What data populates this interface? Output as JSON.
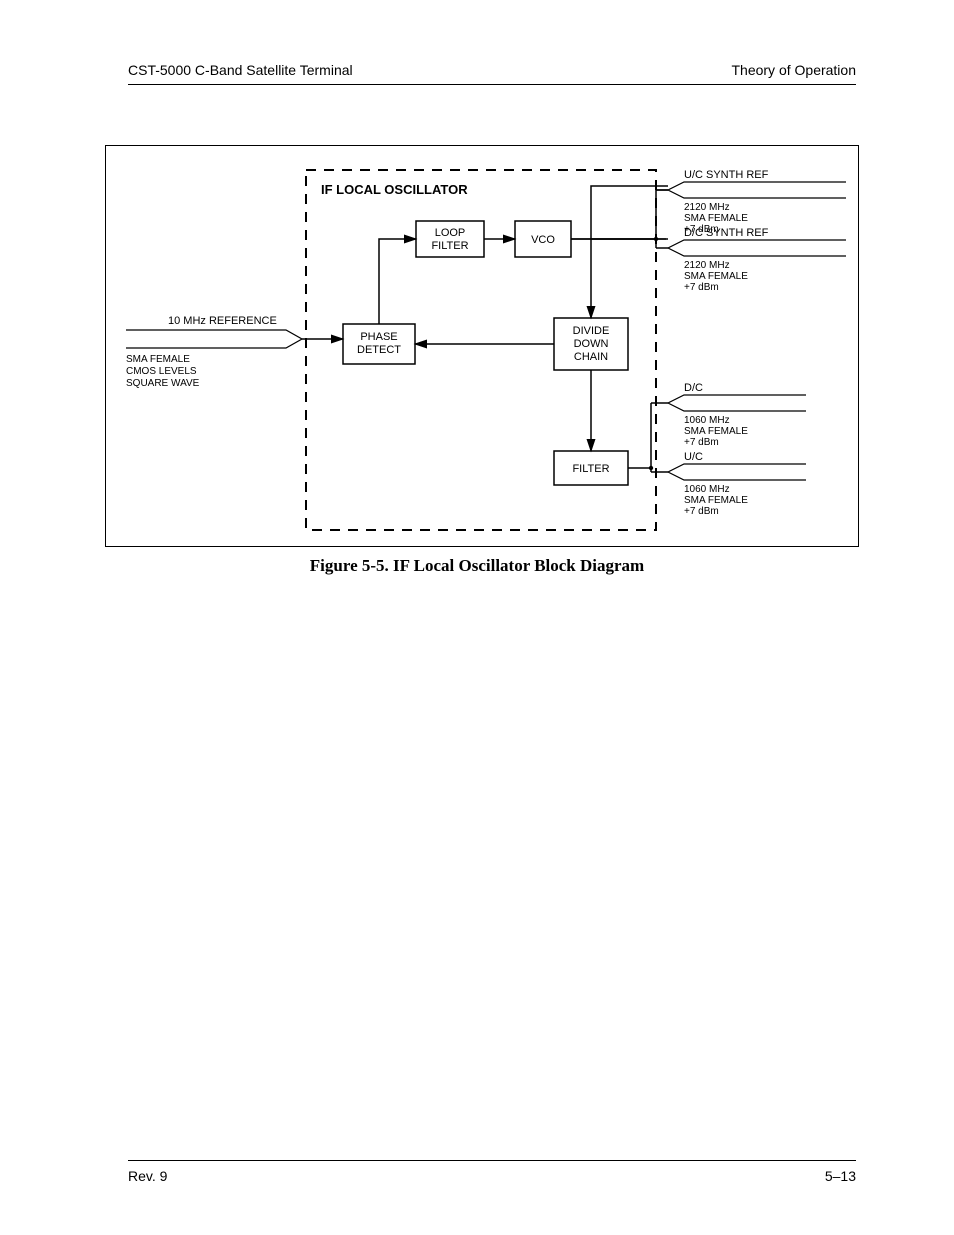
{
  "header": {
    "left": "CST-5000 C-Band Satellite Terminal",
    "right": "Theory of Operation"
  },
  "footer": {
    "left": "Rev. 9",
    "right": "5–13"
  },
  "figure_caption": "Figure 5-5.  IF Local Oscillator Block Diagram",
  "diagram": {
    "title": "IF LOCAL OSCILLATOR",
    "blocks": {
      "loop_filter": "LOOP\nFILTER",
      "vco": "VCO",
      "phase_detect": "PHASE\nDETECT",
      "divide_down_chain": "DIVIDE\nDOWN\nCHAIN",
      "filter": "FILTER"
    },
    "input": {
      "label": "10 MHz REFERENCE",
      "details": "SMA FEMALE\nCMOS LEVELS\nSQUARE WAVE"
    },
    "outputs": {
      "uc_synth_ref": {
        "label": "U/C SYNTH REF",
        "details": "2120 MHz\nSMA FEMALE\n+7 dBm"
      },
      "dc_synth_ref": {
        "label": "D/C SYNTH REF",
        "details": "2120 MHz\nSMA FEMALE\n+7 dBm"
      },
      "dc": {
        "label": "D/C",
        "details": "1060 MHz\nSMA FEMALE\n+7 dBm"
      },
      "uc": {
        "label": "U/C",
        "details": "1060 MHz\nSMA FEMALE\n+7 dBm"
      }
    }
  }
}
